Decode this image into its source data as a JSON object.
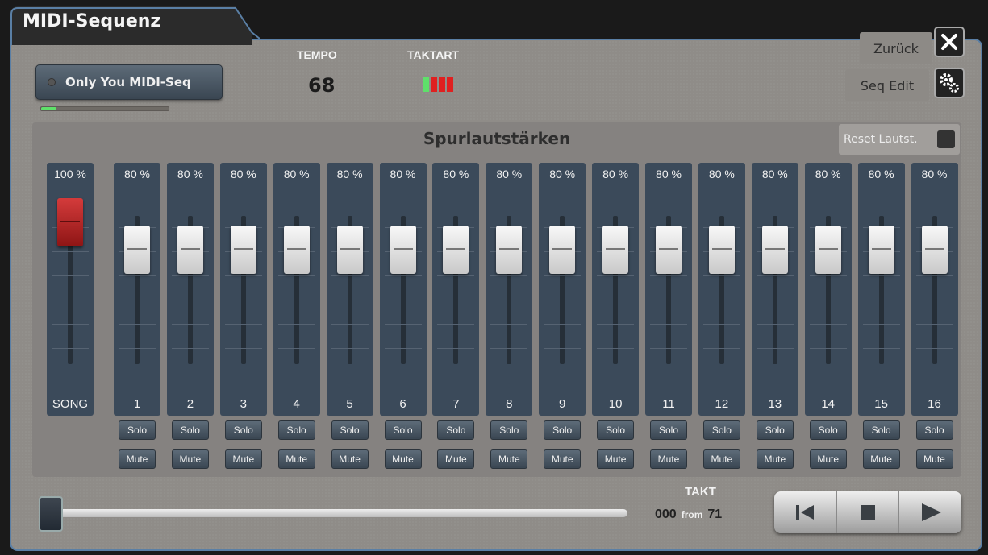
{
  "window": {
    "title": "MIDI-Sequenz"
  },
  "song": {
    "name": "Only You MIDI-Seq",
    "progress": 0.12
  },
  "tempo": {
    "label": "TEMPO",
    "value": "68"
  },
  "taktart": {
    "label": "TAKTART",
    "beats": [
      "#5ee06a",
      "#e02020",
      "#e02020",
      "#e02020"
    ]
  },
  "buttons": {
    "back_label": "Zurück",
    "seq_edit_label": "Seq Edit",
    "reset_label": "Reset Lautst."
  },
  "mixer": {
    "title": "Spurlautstärken",
    "master": {
      "percent": "100 %",
      "label": "SONG",
      "level": 1.0
    },
    "solo_label": "Solo",
    "mute_label": "Mute",
    "channels": [
      {
        "number": "1",
        "percent": "80 %",
        "level": 0.8
      },
      {
        "number": "2",
        "percent": "80 %",
        "level": 0.8
      },
      {
        "number": "3",
        "percent": "80 %",
        "level": 0.8
      },
      {
        "number": "4",
        "percent": "80 %",
        "level": 0.8
      },
      {
        "number": "5",
        "percent": "80 %",
        "level": 0.8
      },
      {
        "number": "6",
        "percent": "80 %",
        "level": 0.8
      },
      {
        "number": "7",
        "percent": "80 %",
        "level": 0.8
      },
      {
        "number": "8",
        "percent": "80 %",
        "level": 0.8
      },
      {
        "number": "9",
        "percent": "80 %",
        "level": 0.8
      },
      {
        "number": "10",
        "percent": "80 %",
        "level": 0.8
      },
      {
        "number": "11",
        "percent": "80 %",
        "level": 0.8
      },
      {
        "number": "12",
        "percent": "80 %",
        "level": 0.8
      },
      {
        "number": "13",
        "percent": "80 %",
        "level": 0.8
      },
      {
        "number": "14",
        "percent": "80 %",
        "level": 0.8
      },
      {
        "number": "15",
        "percent": "80 %",
        "level": 0.8
      },
      {
        "number": "16",
        "percent": "80 %",
        "level": 0.8
      }
    ]
  },
  "takt": {
    "label": "TAKT",
    "current": "000",
    "from_label": "from",
    "total": "71",
    "position": 0.0
  },
  "transport": {
    "icons": [
      "skip-to-start-icon",
      "stop-icon",
      "play-icon"
    ]
  }
}
